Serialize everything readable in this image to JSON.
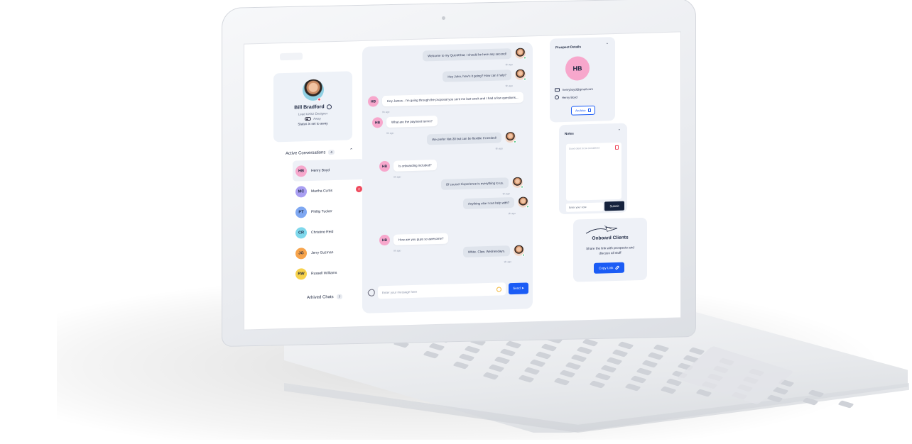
{
  "user": {
    "name": "Bill Bradford",
    "role": "Lead UX/UI Designer",
    "status": "Away",
    "status_note": "Status is set to away"
  },
  "conversations": {
    "heading": "Active Conversations",
    "count": "4",
    "items": [
      {
        "initials": "HB",
        "name": "Henry Boyd",
        "color": "#f7a7cc",
        "unread": ""
      },
      {
        "initials": "MC",
        "name": "Martha Curtis",
        "color": "#a99ff2",
        "unread": "2"
      },
      {
        "initials": "PT",
        "name": "Phillip Tucker",
        "color": "#7fa8f2",
        "unread": ""
      },
      {
        "initials": "CR",
        "name": "Christine Reid",
        "color": "#7fd8ec",
        "unread": ""
      },
      {
        "initials": "JG",
        "name": "Jerry Guzman",
        "color": "#f7a44c",
        "unread": ""
      },
      {
        "initials": "RW",
        "name": "Russell Williams",
        "color": "#f7d24c",
        "unread": ""
      }
    ],
    "archived_label": "Arhived Chats",
    "archived_count": "7"
  },
  "chat": {
    "messages": [
      {
        "dir": "out",
        "text": "Welcome to my QuickChat, I should be here any second!",
        "time": "9h ago"
      },
      {
        "dir": "out",
        "text": "Hey John, how's it going? How can I help?",
        "time": "9h ago"
      },
      {
        "dir": "in",
        "text": "Hey James - I'm going through the proposal you sent me last week and I had a few questions...",
        "time": "9h ago"
      },
      {
        "dir": "in",
        "text": "What are the payment terms?",
        "time": "9h ago"
      },
      {
        "dir": "out",
        "text": "We prefer Net-30 but can be flexible if needed!",
        "time": "9h ago"
      },
      {
        "dir": "in",
        "text": "Is onboarding included?",
        "time": "9h ago"
      },
      {
        "dir": "out",
        "text": "Of course! Experience is everything to us.",
        "time": "9h ago"
      },
      {
        "dir": "out",
        "text": "Anything else I can help with?",
        "time": "9h ago"
      },
      {
        "dir": "in",
        "text": "How are you guys so awesome?",
        "time": "9h ago"
      },
      {
        "dir": "out",
        "text": "White. Claw. Wednesdays.",
        "time": "9h ago"
      }
    ],
    "contact_initials": "HB",
    "input_placeholder": "Enter your message here",
    "send_label": "Send"
  },
  "prospect": {
    "title": "Prospect Details",
    "initials": "HB",
    "email": "henryboyd@gmail.com",
    "name": "Henry Boyd",
    "archive_label": "Archive"
  },
  "notes": {
    "title": "Notes",
    "placeholder": "Good client to be considered",
    "input_placeholder": "Enter your note",
    "submit_label": "Submit"
  },
  "onboard": {
    "title": "Onboard Clients",
    "description": "Share the link with prospects and discuss all stuff",
    "button_label": "Copy Link"
  },
  "colors": {
    "accent": "#1b5cf5",
    "alert": "#ef4a5d",
    "panel": "#eef1f7",
    "dark_button": "#15223d"
  }
}
